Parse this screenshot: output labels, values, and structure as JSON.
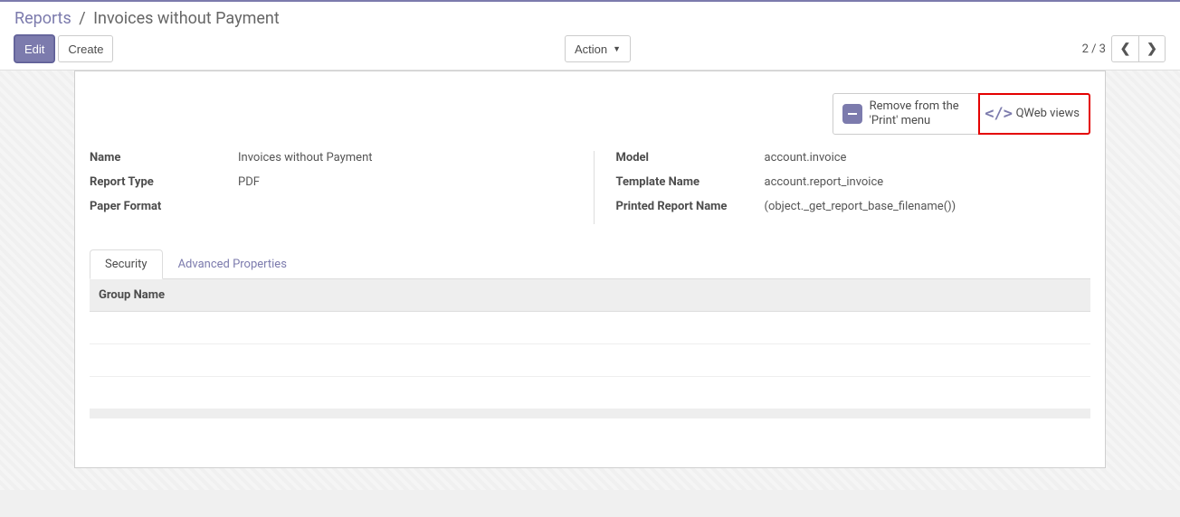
{
  "breadcrumb": {
    "parent": "Reports",
    "separator": "/",
    "current": "Invoices without Payment"
  },
  "controls": {
    "edit": "Edit",
    "create": "Create",
    "action": "Action"
  },
  "pager": {
    "text": "2 / 3"
  },
  "stat_buttons": {
    "remove_print": "Remove from the 'Print' menu",
    "qweb": "QWeb views"
  },
  "form": {
    "left": {
      "name_label": "Name",
      "name_value": "Invoices without Payment",
      "report_type_label": "Report Type",
      "report_type_value": "PDF",
      "paper_format_label": "Paper Format",
      "paper_format_value": ""
    },
    "right": {
      "model_label": "Model",
      "model_value": "account.invoice",
      "template_label": "Template Name",
      "template_value": "account.report_invoice",
      "printed_label": "Printed Report Name",
      "printed_value": "(object._get_report_base_filename())"
    }
  },
  "tabs": {
    "security": "Security",
    "advanced": "Advanced Properties"
  },
  "table": {
    "col_group_name": "Group Name"
  }
}
